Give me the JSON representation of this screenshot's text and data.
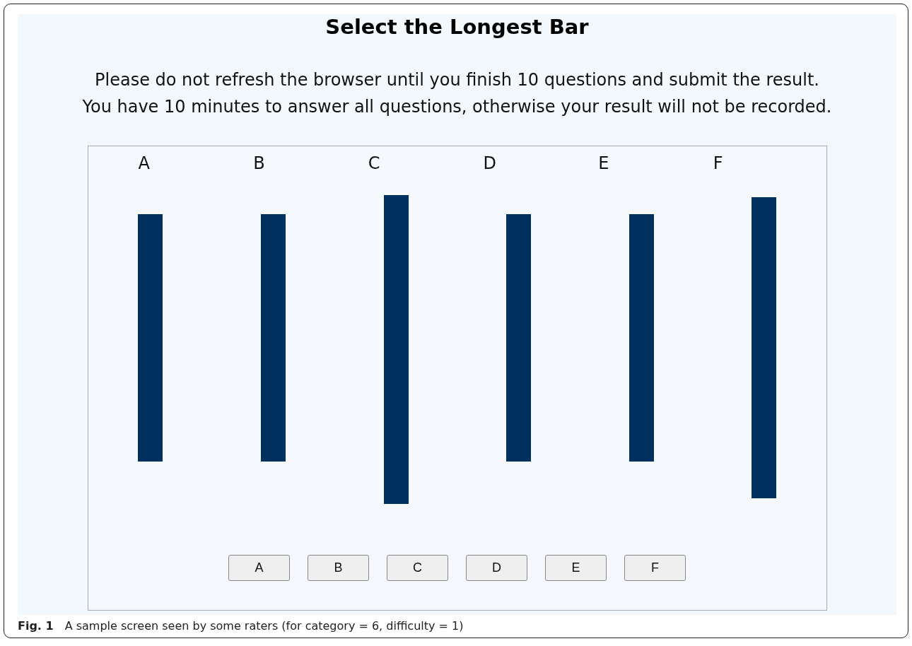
{
  "title": "Select the Longest Bar",
  "instructions": [
    "Please do not refresh the browser until you finish 10 questions and submit the result.",
    "You have 10 minutes to answer all questions, otherwise your result will not be recorded."
  ],
  "bar_labels": [
    "A",
    "B",
    "C",
    "D",
    "E",
    "F"
  ],
  "answer_buttons": [
    "A",
    "B",
    "C",
    "D",
    "E",
    "F"
  ],
  "caption": {
    "label": "Fig. 1",
    "text": "A sample screen seen by some raters (for category = 6, difficulty = 1)"
  }
}
